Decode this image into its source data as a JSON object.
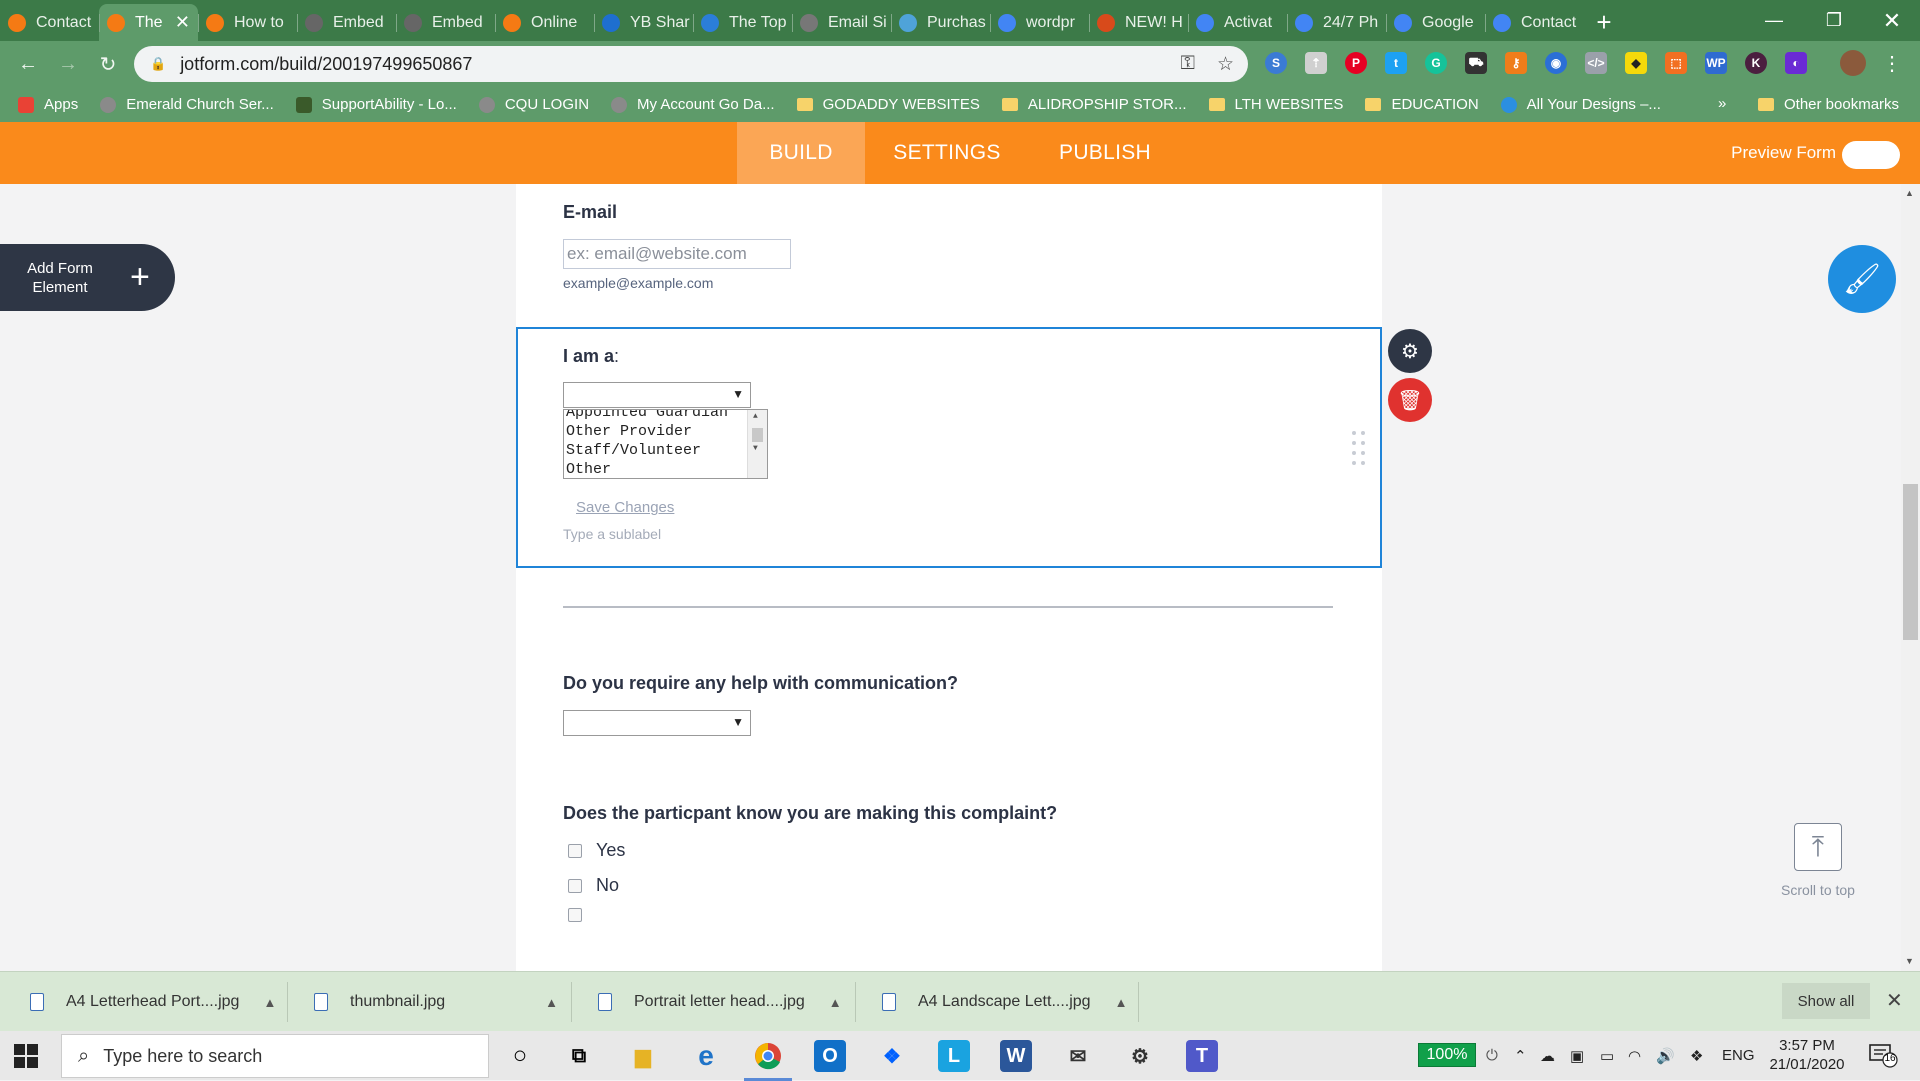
{
  "browser": {
    "tabs": [
      {
        "label": "Contact",
        "icon": "jotform-icon",
        "color": "#f57a14",
        "active": false
      },
      {
        "label": "The",
        "icon": "jotform-icon",
        "color": "#f57a14",
        "active": true
      },
      {
        "label": "How to",
        "icon": "jotform-icon",
        "color": "#f57a14",
        "active": false
      },
      {
        "label": "Embed",
        "icon": "wordpress-icon",
        "color": "#666666",
        "active": false
      },
      {
        "label": "Embed",
        "icon": "wordpress-icon",
        "color": "#666666",
        "active": false
      },
      {
        "label": "Online",
        "icon": "jotform-icon",
        "color": "#f57a14",
        "active": false
      },
      {
        "label": "YB Shar",
        "icon": "yb-icon",
        "color": "#1e6fcf",
        "active": false
      },
      {
        "label": "The Top",
        "icon": "blue-icon",
        "color": "#2b7ed8",
        "active": false
      },
      {
        "label": "Email Si",
        "icon": "generic-icon",
        "color": "#777777",
        "active": false
      },
      {
        "label": "Purchas",
        "icon": "purchase-icon",
        "color": "#4fa3d9",
        "active": false
      },
      {
        "label": "wordpr",
        "icon": "google-icon",
        "color": "#4285f4",
        "active": false
      },
      {
        "label": "NEW! H",
        "icon": "new-icon",
        "color": "#d84a1b",
        "active": false
      },
      {
        "label": "Activat",
        "icon": "google-icon",
        "color": "#4285f4",
        "active": false
      },
      {
        "label": "24/7 Ph",
        "icon": "google-icon",
        "color": "#4285f4",
        "active": false
      },
      {
        "label": "Google",
        "icon": "google-icon",
        "color": "#4285f4",
        "active": false
      },
      {
        "label": "Contact",
        "icon": "google-icon",
        "color": "#4285f4",
        "active": false
      }
    ],
    "active_tab_close": "✕",
    "new_tab": "+",
    "url": "jotform.com/build/200197499650867",
    "bookmarks": [
      {
        "label": "Apps",
        "type": "apps"
      },
      {
        "label": "Emerald Church Ser...",
        "type": "globe"
      },
      {
        "label": "SupportAbility - Lo...",
        "type": "site"
      },
      {
        "label": "CQU LOGIN",
        "type": "globe"
      },
      {
        "label": "My Account Go Da...",
        "type": "globe"
      },
      {
        "label": "GODADDY WEBSITES",
        "type": "folder"
      },
      {
        "label": "ALIDROPSHIP STOR...",
        "type": "folder"
      },
      {
        "label": "LTH WEBSITES",
        "type": "folder"
      },
      {
        "label": "EDUCATION",
        "type": "folder"
      },
      {
        "label": "All Your Designs –...",
        "type": "canva"
      }
    ],
    "bookmarks_more": "»",
    "other_bookmarks": "Other bookmarks"
  },
  "jotform": {
    "tabs": [
      "BUILD",
      "SETTINGS",
      "PUBLISH"
    ],
    "active_tab": "BUILD",
    "preview_label": "Preview Form",
    "add_element_label": "Add Form Element",
    "fields": {
      "email_label": "E-mail",
      "email_placeholder": "ex: email@website.com",
      "email_sublabel": "example@example.com",
      "iam_label": "I am a",
      "iam_colon": ":",
      "iam_options_lines": [
        "Appointed Guardian",
        "Other Provider",
        "Staff/Volunteer",
        "Other"
      ],
      "save_changes": "Save Changes",
      "sublabel_placeholder": "Type a sublabel",
      "comm_label": "Do you require any help with communication?",
      "complaint_label": "Does the particpant know you are making this complaint?",
      "complaint_options": [
        "Yes",
        "No",
        ""
      ]
    },
    "scroll_to_top": "Scroll to top"
  },
  "downloads": {
    "items": [
      "A4 Letterhead Port....jpg",
      "thumbnail.jpg",
      "Portrait letter head....jpg",
      "A4  Landscape Lett....jpg"
    ],
    "show_all": "Show all"
  },
  "taskbar": {
    "search_placeholder": "Type here to search",
    "battery": "100%",
    "language": "ENG",
    "time": "3:57 PM",
    "date": "21/01/2020",
    "notification_count": "16"
  }
}
